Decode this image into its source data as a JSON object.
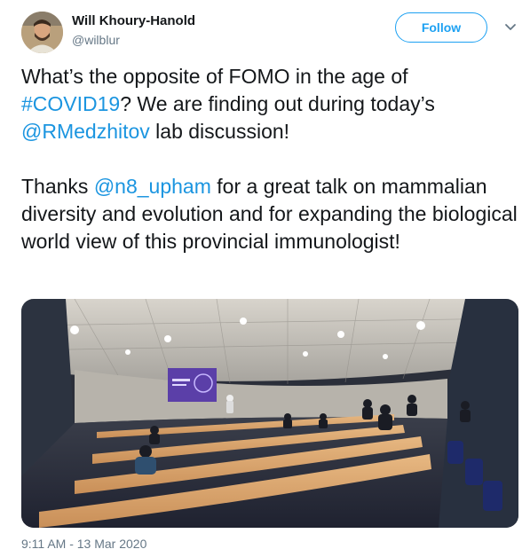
{
  "author": {
    "display_name": "Will Khoury-Hanold",
    "handle": "@wilblur"
  },
  "actions": {
    "follow_label": "Follow",
    "menu_icon": "chevron-down-icon"
  },
  "tweet": {
    "p1_a": "What’s the opposite of FOMO in the age of ",
    "hashtag": "#COVID19",
    "p1_b": "? We are finding out during today’s ",
    "mention1": "@RMedzhitov",
    "p1_c": " lab discussion!",
    "p2_a": "Thanks ",
    "mention2": "@n8_upham",
    "p2_b": " for a great talk on mammalian diversity and evolution and for expanding the biological world view of this provincial immunologist!"
  },
  "timestamp": "9:11 AM - 13 Mar 2020",
  "colors": {
    "link": "#1b95e0",
    "follow": "#1da1f2",
    "secondary_text": "#657786"
  }
}
